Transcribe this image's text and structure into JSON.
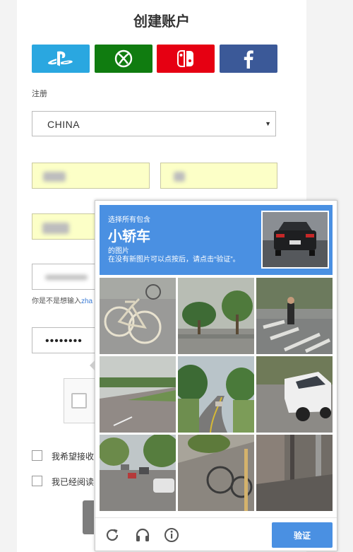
{
  "page": {
    "title": "创建账户",
    "register_label": "注册",
    "region_value": "CHINA",
    "hint_prefix": "你是不是想输入",
    "hint_link": "zha",
    "password_mask": "••••••••",
    "checkbox_1_label": "我希望接收",
    "checkbox_2_label": "我已经阅读"
  },
  "social": [
    {
      "name": "playstation",
      "color": "#2aa7e0"
    },
    {
      "name": "xbox",
      "color": "#107c10"
    },
    {
      "name": "nintendo-switch",
      "color": "#e60012"
    },
    {
      "name": "facebook",
      "color": "#3b5998"
    }
  ],
  "colors": {
    "autofill_yellow": "#fcffc7",
    "challenge_blue": "#4a90e2"
  },
  "challenge": {
    "instruction_line1": "选择所有包含",
    "target": "小轿车",
    "instruction_line2": "的图片",
    "instruction_line3": "在没有新图片可以点按后，请点击“验证”。",
    "verify_label": "验证",
    "tiles": [
      "bicycle",
      "palm-trees-street",
      "pedestrian-crosswalk",
      "road-grass",
      "curvy-road",
      "parked-suv",
      "highway-cars",
      "bicycle-sidewalk",
      "sidewalk-pole"
    ],
    "footer_icons": [
      "reload-icon",
      "audio-icon",
      "info-icon"
    ]
  }
}
